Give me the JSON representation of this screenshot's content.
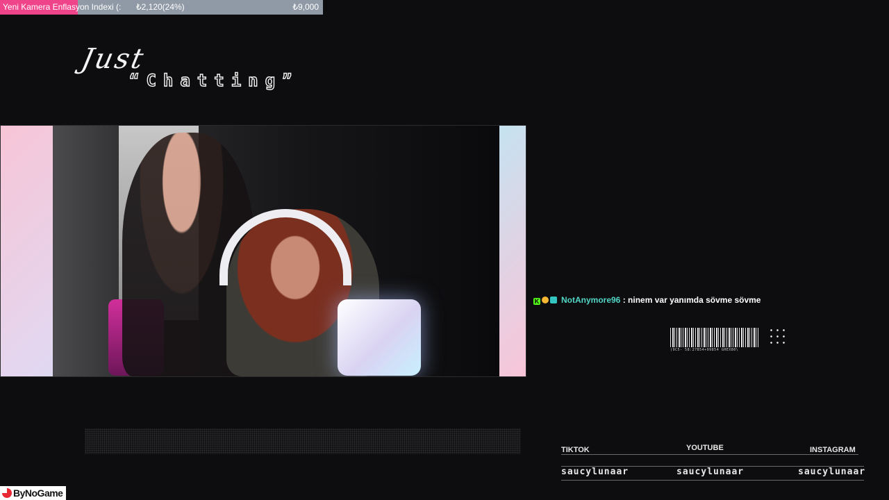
{
  "donation_goal": {
    "title": "Yeni Kamera Enflasyon Indexi (:",
    "current": "₺2,120(24%)",
    "target": "₺9,000",
    "progress_percent": 24,
    "fill_color": "#f0448a",
    "track_color": "#8f9aa6"
  },
  "category": {
    "script": "Just",
    "main": "“Chatting”"
  },
  "chat": {
    "badges": [
      "kick-badge-icon",
      "gold-badge-icon",
      "subscriber-badge-icon"
    ],
    "badge_letter": "K",
    "username": "NotAnymore96",
    "separator": ":",
    "message": "ninem var yanımda sövme sövme",
    "username_color": "#52d6c6"
  },
  "barcode": {
    "caption": "(9C5- 58:27854+99854 GHEX80\\"
  },
  "socials": [
    {
      "label": "TIKTOK",
      "handle": "saucylunaar"
    },
    {
      "label": "YOUTUBE",
      "handle": "saucylunaar"
    },
    {
      "label": "INSTAGRAM",
      "handle": "saucylunaar"
    }
  ],
  "logo": {
    "text": "ByNoGame",
    "color": "#e82934"
  }
}
